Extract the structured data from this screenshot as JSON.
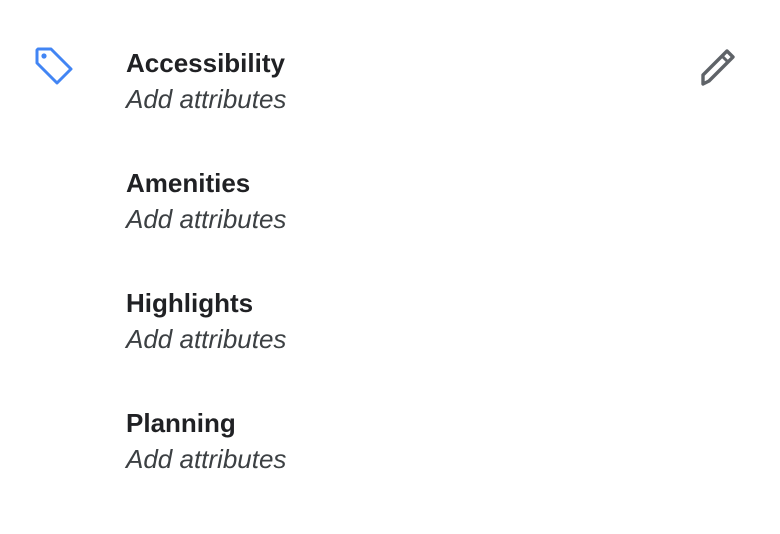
{
  "icons": {
    "category": "tag-icon",
    "edit": "pencil-icon"
  },
  "colors": {
    "accent": "#4285f4",
    "icon_gray": "#5f6368",
    "text": "#202124"
  },
  "groups": [
    {
      "title": "Accessibility",
      "subtitle": "Add attributes"
    },
    {
      "title": "Amenities",
      "subtitle": "Add attributes"
    },
    {
      "title": "Highlights",
      "subtitle": "Add attributes"
    },
    {
      "title": "Planning",
      "subtitle": "Add attributes"
    }
  ]
}
